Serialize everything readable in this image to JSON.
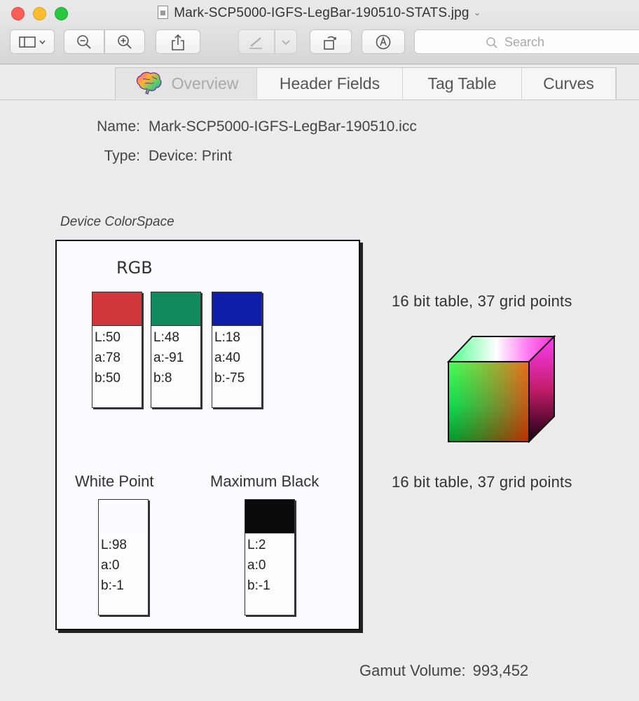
{
  "window": {
    "title": "Mark-SCP5000-IGFS-LegBar-190510-STATS.jpg",
    "title_chevron": "⌄"
  },
  "toolbar": {
    "search_placeholder": "Search",
    "buttons": [
      "sidebar-toggle",
      "zoom-out",
      "zoom-in",
      "share",
      "markup",
      "markup-menu",
      "rotate",
      "annotate"
    ]
  },
  "tabs": [
    {
      "label": "Overview",
      "active": true
    },
    {
      "label": "Header Fields",
      "active": false
    },
    {
      "label": "Tag Table",
      "active": false
    },
    {
      "label": "Curves",
      "active": false
    }
  ],
  "profile": {
    "name_label": "Name:",
    "name_value": "Mark-SCP5000-IGFS-LegBar-190510.icc",
    "type_label": "Type:",
    "type_value": "Device: Print"
  },
  "device_colorspace": {
    "caption": "Device ColorSpace",
    "space": "RGB",
    "primaries": [
      {
        "color": "#d1373a",
        "L": "L:50",
        "a": "a:78",
        "b": "b:50"
      },
      {
        "color": "#128a60",
        "L": "L:48",
        "a": "a:-91",
        "b": "b:8"
      },
      {
        "color": "#0f1ea8",
        "L": "L:18",
        "a": "a:40",
        "b": "b:-75"
      }
    ],
    "white_point": {
      "label": "White Point",
      "color": "#fbfbfd",
      "L": "L:98",
      "a": "a:0",
      "b": "b:-1"
    },
    "max_black": {
      "label": "Maximum Black",
      "color": "#0a0a0a",
      "L": "L:2",
      "a": "a:0",
      "b": "b:-1"
    }
  },
  "tables": {
    "a2b_caption": "16 bit table, 37 grid points",
    "b2a_caption": "16 bit table, 37 grid points"
  },
  "gamut": {
    "label": "Gamut Volume:",
    "value": "993,452"
  }
}
